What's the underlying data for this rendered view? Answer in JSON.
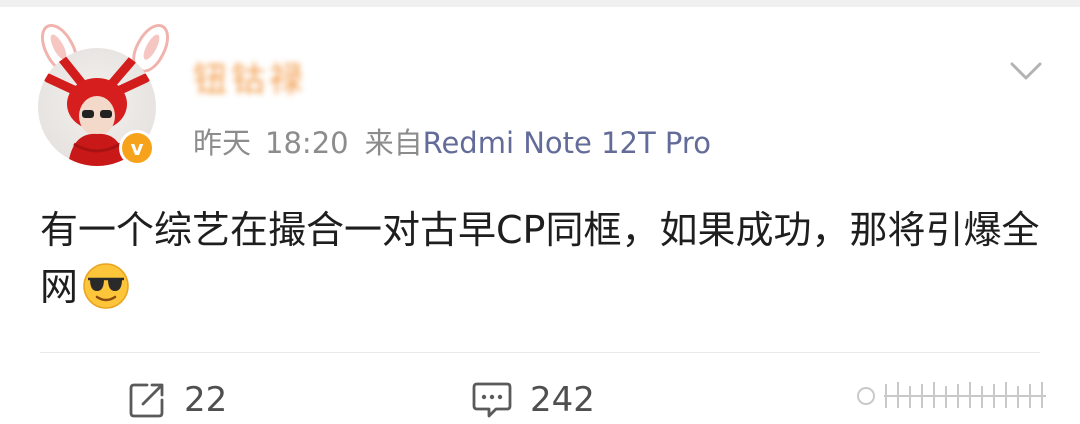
{
  "colors": {
    "username": "#f08c2e",
    "meta": "#8c8c8c",
    "device_link": "#636c99",
    "body_text": "#1e1e1e",
    "badge": "#f7a21b",
    "action_text": "#4f4f4f"
  },
  "post": {
    "author": {
      "name": "钮钴禄",
      "verified": true,
      "verified_badge_glyph": "v"
    },
    "meta": {
      "date": "昨天",
      "time": "18:20",
      "from_label": "来自",
      "device": "Redmi Note 12T Pro"
    },
    "body": {
      "text": "有一个综艺在撮合一对古早CP同框，如果成功，那将引爆全网",
      "emoji": "sunglasses-emoji"
    },
    "actions": {
      "repost": {
        "icon": "repost-icon",
        "count": "22"
      },
      "comment": {
        "icon": "comment-icon",
        "count": "242"
      }
    },
    "menu": {
      "icon": "chevron-down-icon"
    }
  }
}
